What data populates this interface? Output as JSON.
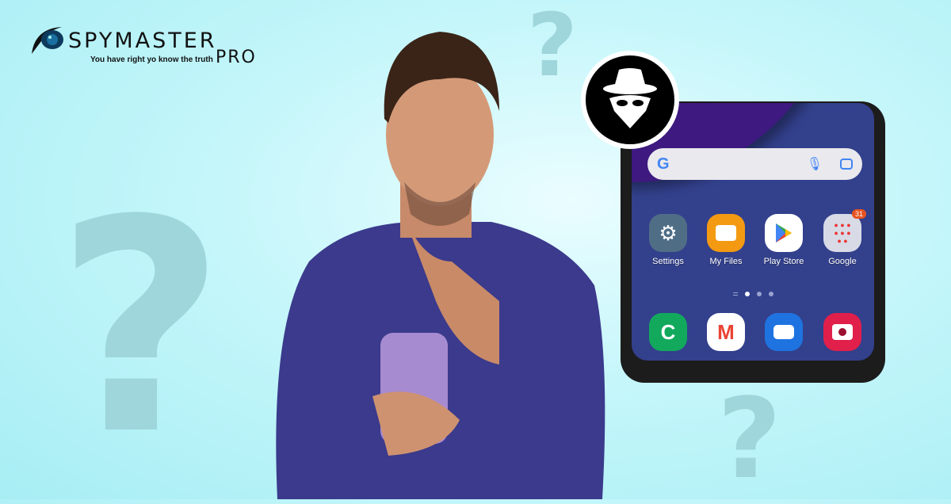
{
  "logo": {
    "brand": "SPYMASTER",
    "suffix": "PRO",
    "tagline": "You have right yo know the truth"
  },
  "decor": {
    "question_mark": "?"
  },
  "phone": {
    "search": {
      "google_logo": "G",
      "icons": [
        "mic-icon",
        "lens-icon"
      ]
    },
    "apps": [
      {
        "label": "Settings",
        "icon": "gear-icon",
        "color": "#4f6e86"
      },
      {
        "label": "My Files",
        "icon": "folder-icon",
        "color": "#f39a12"
      },
      {
        "label": "Play Store",
        "icon": "play-store-icon",
        "color": "#ffffff"
      },
      {
        "label": "Google",
        "icon": "folder-grid-icon",
        "color": "#d8dbe6",
        "badge": "31"
      }
    ],
    "dock": [
      {
        "icon": "phone-icon",
        "color": "#12a95d"
      },
      {
        "icon": "gmail-icon",
        "color": "#ffffff"
      },
      {
        "icon": "messages-icon",
        "color": "#1f73e0"
      },
      {
        "icon": "camera-icon",
        "color": "#e0204a"
      }
    ]
  },
  "colors": {
    "background": "#b9f3f8",
    "shirt": "#3b3a8c",
    "phone_wallpaper": "#33408c"
  }
}
